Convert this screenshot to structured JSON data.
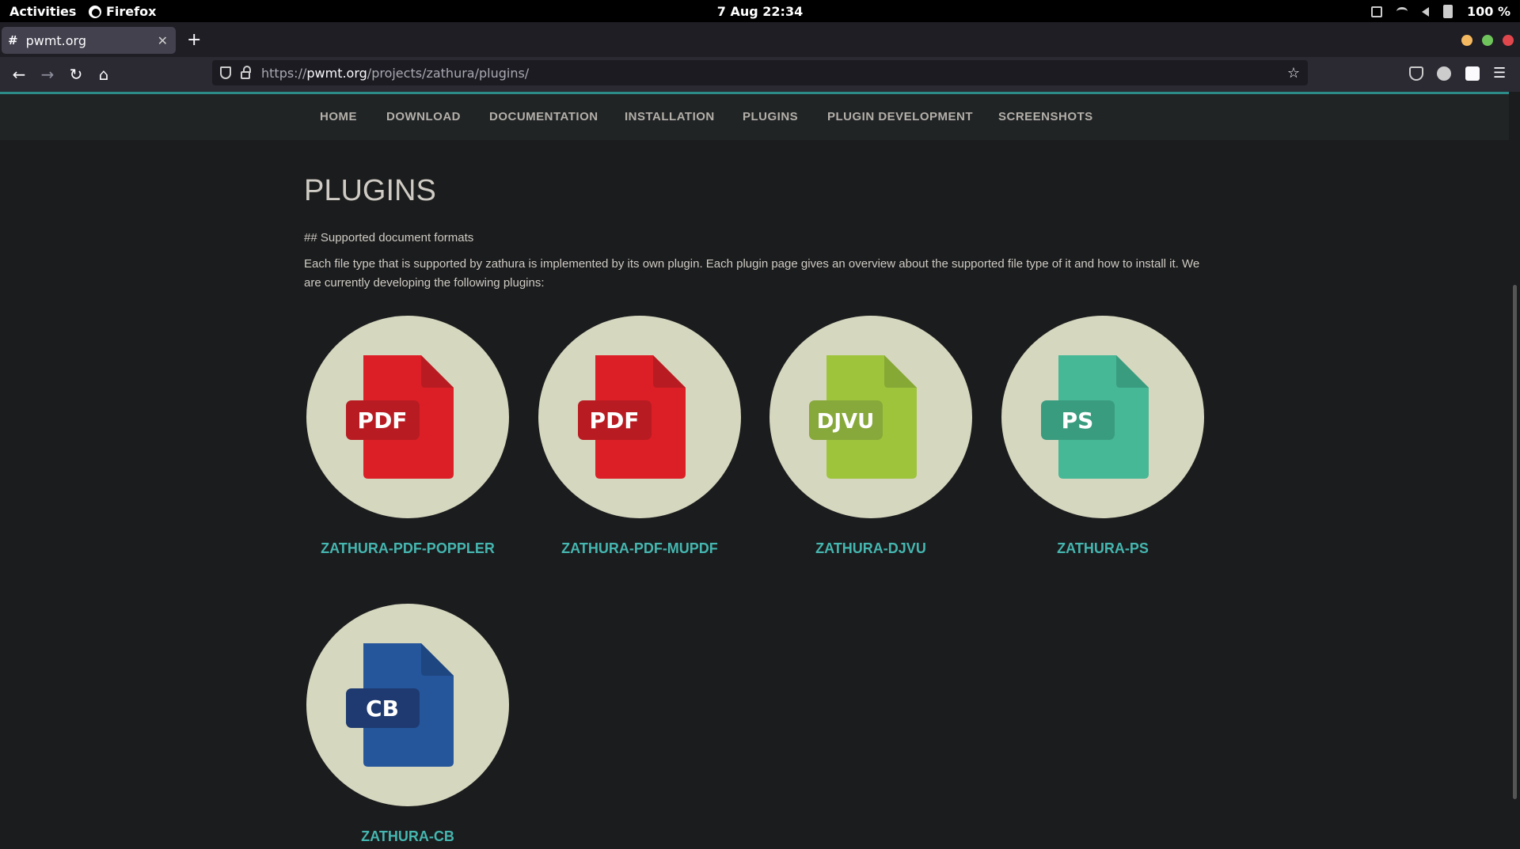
{
  "system": {
    "activities": "Activities",
    "app_name": "Firefox",
    "clock": "7 Aug  22:34",
    "battery": "100 %"
  },
  "browser": {
    "tab_title": "pwmt.org",
    "tab_favicon": "#",
    "new_tab": "+",
    "url_prefix": "https://",
    "url_host": "pwmt.org",
    "url_path": "/projects/zathura/plugins/"
  },
  "site_nav": [
    "HOME",
    "DOWNLOAD",
    "DOCUMENTATION",
    "INSTALLATION",
    "PLUGINS",
    "PLUGIN DEVELOPMENT",
    "SCREENSHOTS"
  ],
  "page": {
    "title": "PLUGINS",
    "subtitle": "## Supported document formats",
    "description": "Each file type that is supported by zathura is implemented by its own plugin. Each plugin page gives an overview about the supported file type of it and how to install it. We are currently developing the following plugins:"
  },
  "plugins": [
    {
      "name": "ZATHURA-PDF-POPPLER",
      "badge": "PDF",
      "icon": "pdf-file-icon",
      "color": "#dc1f26",
      "fold": "#b81c22",
      "badge_color": "#b81c22"
    },
    {
      "name": "ZATHURA-PDF-MUPDF",
      "badge": "PDF",
      "icon": "pdf-file-icon",
      "color": "#dc1f26",
      "fold": "#b81c22",
      "badge_color": "#b81c22"
    },
    {
      "name": "ZATHURA-DJVU",
      "badge": "DJVU",
      "icon": "djvu-file-icon",
      "color": "#9ec43c",
      "fold": "#86a835",
      "badge_color": "#87a83a"
    },
    {
      "name": "ZATHURA-PS",
      "badge": "PS",
      "icon": "ps-file-icon",
      "color": "#46b896",
      "fold": "#3a9c7f",
      "badge_color": "#3a9c7f"
    },
    {
      "name": "ZATHURA-CB",
      "badge": "CB",
      "icon": "cb-file-icon",
      "color": "#25559b",
      "fold": "#1e4680",
      "badge_color": "#1e3a70"
    }
  ]
}
